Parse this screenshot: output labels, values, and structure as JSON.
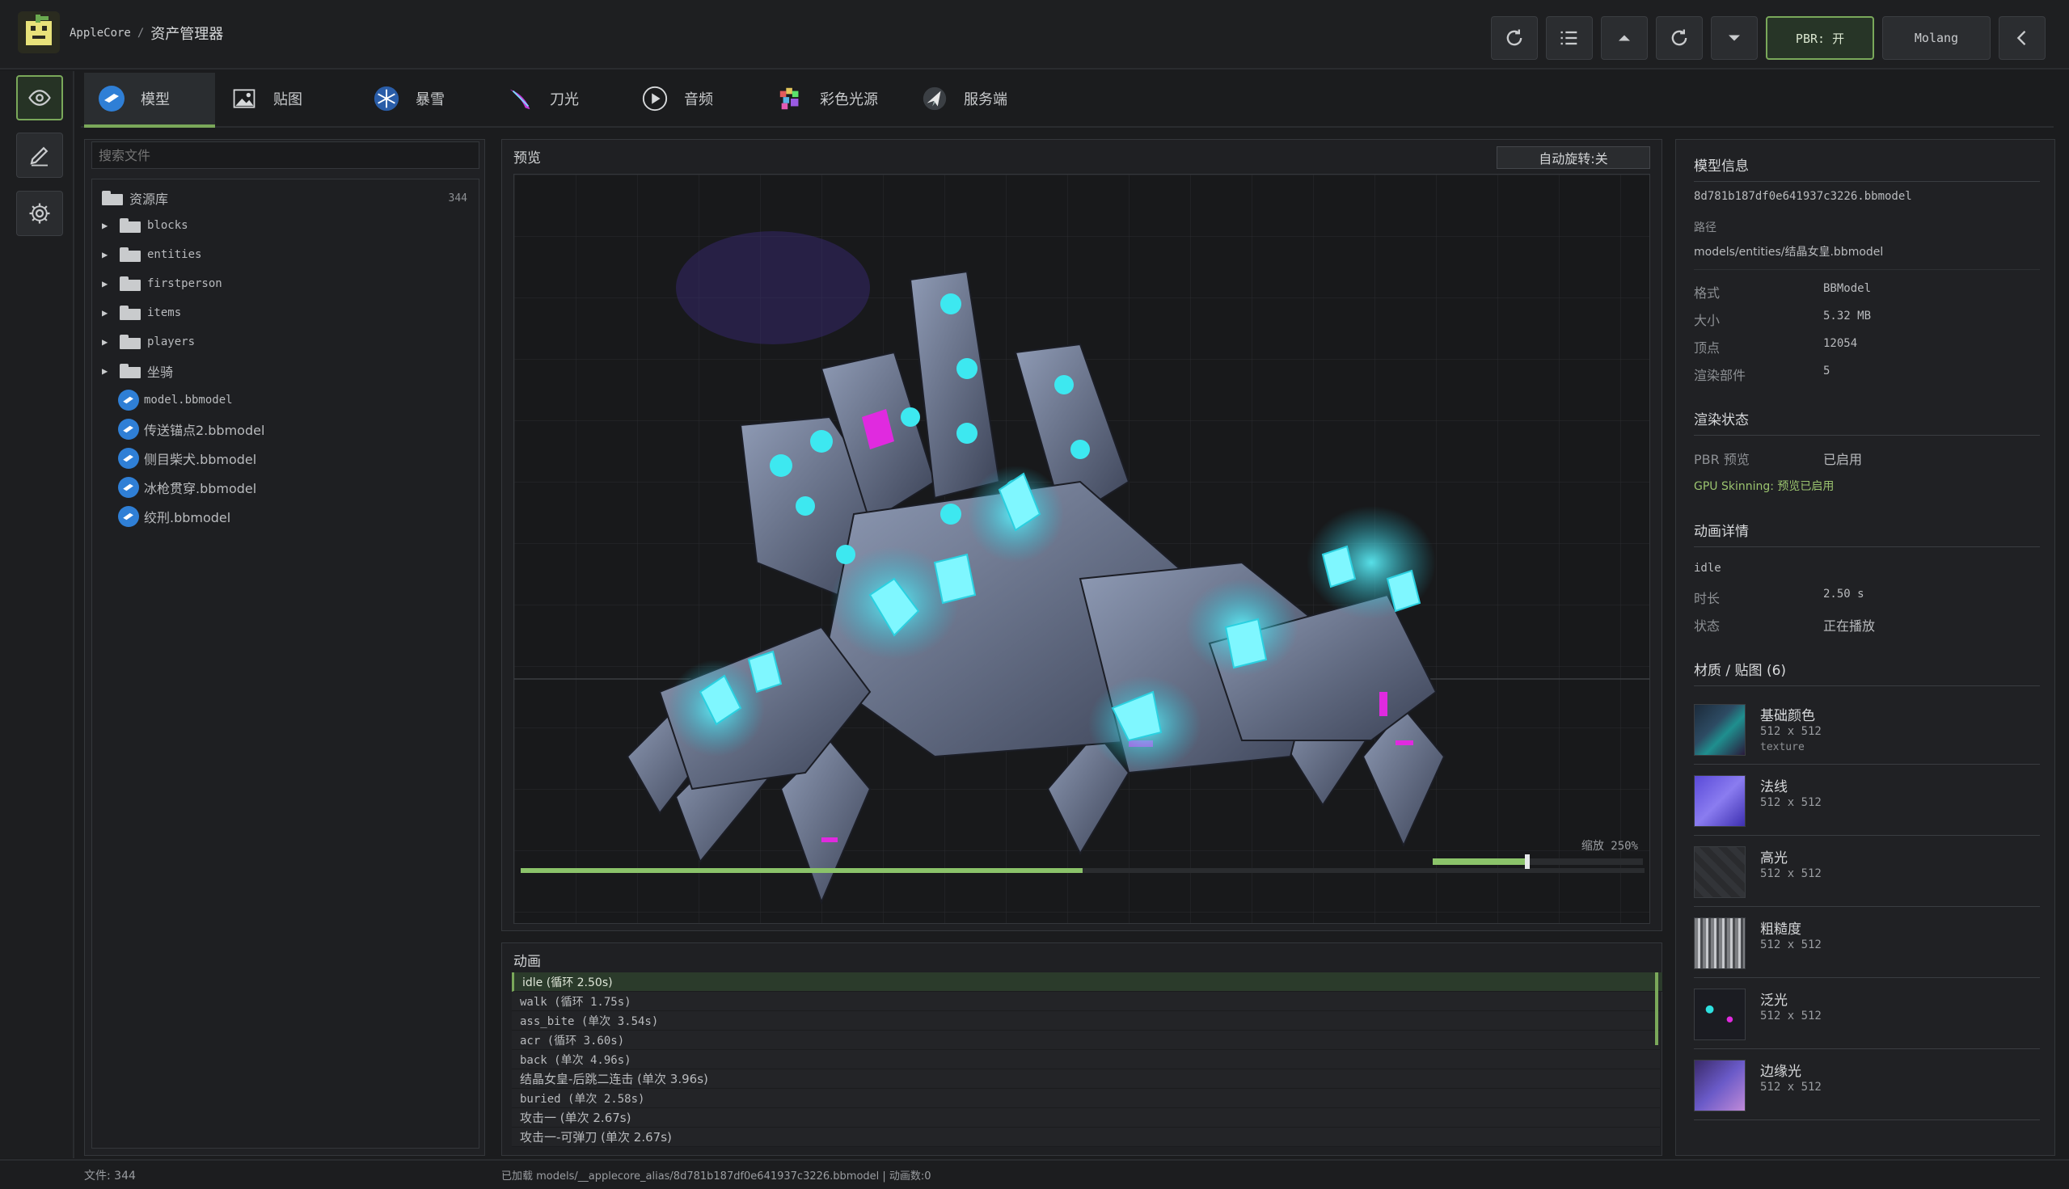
{
  "header": {
    "project": "AppleCore",
    "separator": "/",
    "title": "资产管理器",
    "pbr_label": "PBR: 开",
    "molang_label": "Molang",
    "toolbar_icons": [
      "refresh-icon",
      "list-icon",
      "caret-up-icon",
      "refresh-icon",
      "caret-down-icon",
      "chevron-left-icon"
    ]
  },
  "rail": {
    "items": [
      "eye-icon",
      "pencil-icon",
      "gear-icon"
    ],
    "active": "eye-icon"
  },
  "tabs": [
    {
      "label": "模型",
      "icon": "model-icon",
      "active": true
    },
    {
      "label": "贴图",
      "icon": "image-icon",
      "active": false
    },
    {
      "label": "暴雪",
      "icon": "snowflake-icon",
      "active": false
    },
    {
      "label": "刀光",
      "icon": "blade-icon",
      "active": false
    },
    {
      "label": "音频",
      "icon": "play-icon",
      "active": false
    },
    {
      "label": "彩色光源",
      "icon": "rainbow-light-icon",
      "active": false
    },
    {
      "label": "服务端",
      "icon": "server-icon",
      "active": false
    }
  ],
  "files": {
    "search_placeholder": "搜索文件",
    "root_label": "资源库",
    "root_count": "344",
    "folders": [
      "blocks",
      "entities",
      "firstperson",
      "items",
      "players",
      "坐骑"
    ],
    "models": [
      "model.bbmodel",
      "传送锚点2.bbmodel",
      "侧目柴犬.bbmodel",
      "冰枪贯穿.bbmodel",
      "绞刑.bbmodel"
    ]
  },
  "preview": {
    "title": "预览",
    "autorotate_label": "自动旋转:关",
    "zoom_label": "缩放 250%",
    "zoom_fraction": 0.45,
    "timeline_fraction": 0.5
  },
  "animations": {
    "title": "动画",
    "items": [
      {
        "label": "idle (循环 2.50s)",
        "active": true
      },
      {
        "label": "walk (循环 1.75s)",
        "active": false
      },
      {
        "label": "ass_bite (单次 3.54s)",
        "active": false
      },
      {
        "label": "acr (循环 3.60s)",
        "active": false
      },
      {
        "label": "back (单次 4.96s)",
        "active": false
      },
      {
        "label": "结晶女皇-后跳二连击 (单次 3.96s)",
        "active": false
      },
      {
        "label": "buried (单次 2.58s)",
        "active": false
      },
      {
        "label": "攻击一 (单次 2.67s)",
        "active": false
      },
      {
        "label": "攻击一-可弹刀 (单次 2.67s)",
        "active": false
      }
    ]
  },
  "info": {
    "section_title": "模型信息",
    "file_name": "8d781b187df0e641937c3226.bbmodel",
    "path_label": "路径",
    "path_value": "models/entities/结晶女皇.bbmodel",
    "props": [
      {
        "key": "格式",
        "value": "BBModel"
      },
      {
        "key": "大小",
        "value": "5.32 MB"
      },
      {
        "key": "顶点",
        "value": "12054"
      },
      {
        "key": "渲染部件",
        "value": "5"
      }
    ],
    "render_title": "渲染状态",
    "pbr_key": "PBR 预览",
    "pbr_value": "已启用",
    "gpu_line": "GPU Skinning: 预览已启用",
    "anim_title": "动画详情",
    "anim_name": "idle",
    "anim_props": [
      {
        "key": "时长",
        "value": "2.50 s"
      },
      {
        "key": "状态",
        "value": "正在播放"
      }
    ],
    "materials_title": "材质 / 贴图 (6)",
    "materials": [
      {
        "name": "基础颜色",
        "size": "512 x 512",
        "kind": "texture"
      },
      {
        "name": "法线",
        "size": "512 x 512",
        "kind": ""
      },
      {
        "name": "高光",
        "size": "512 x 512",
        "kind": ""
      },
      {
        "name": "粗糙度",
        "size": "512 x 512",
        "kind": ""
      },
      {
        "name": "泛光",
        "size": "512 x 512",
        "kind": ""
      },
      {
        "name": "边缘光",
        "size": "512 x 512",
        "kind": ""
      }
    ]
  },
  "status": {
    "files_label": "文件: 344",
    "loaded_label": "已加载 models/__applecore_alias/8d781b187df0e641937c3226.bbmodel | 动画数:0"
  },
  "colors": {
    "accent": "#7aa85a",
    "crystal": "#3de8f0",
    "magenta": "#e02adf",
    "bg": "#1b1c1e"
  }
}
